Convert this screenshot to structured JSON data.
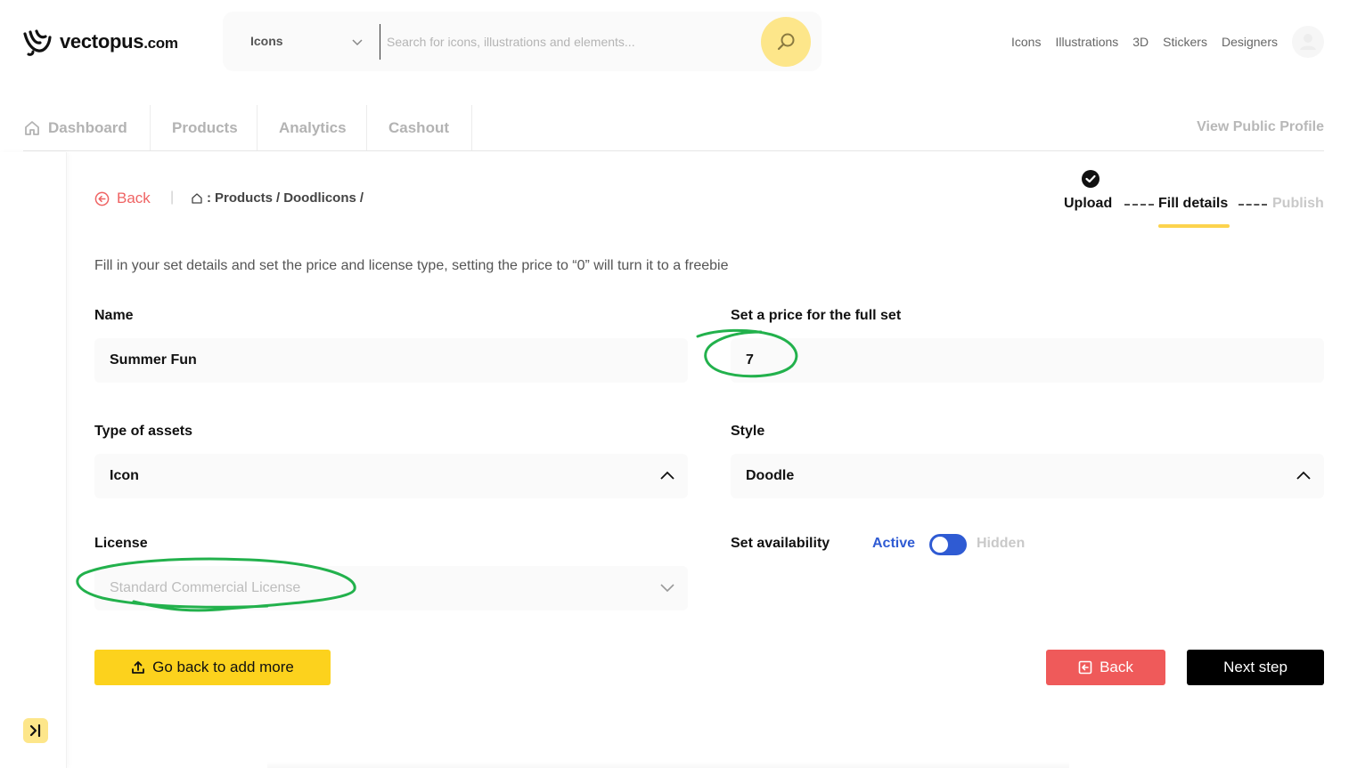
{
  "brand": {
    "name": "vectopus",
    "suffix": ".com"
  },
  "search": {
    "category": "Icons",
    "placeholder": "Search for icons, illustrations and elements..."
  },
  "topnav": [
    "Icons",
    "Illustrations",
    "3D",
    "Stickers",
    "Designers"
  ],
  "tabs": [
    {
      "label": "Dashboard",
      "icon": "home-icon"
    },
    {
      "label": "Products"
    },
    {
      "label": "Analytics"
    },
    {
      "label": "Cashout"
    }
  ],
  "view_profile": "View Public Profile",
  "back_label": "Back",
  "breadcrumb": {
    "root_sep": ":",
    "items": [
      "Products",
      "Doodlicons"
    ],
    "sep": "/"
  },
  "stepper": {
    "steps": [
      "Upload",
      "Fill details",
      "Publish"
    ],
    "completed": [
      "Upload"
    ],
    "current": "Fill details"
  },
  "intro": "Fill in your set details and set the price and license type, setting the price to “0” will turn it to a freebie",
  "form": {
    "name_label": "Name",
    "name_value": "Summer Fun",
    "price_label": "Set a price for the full set",
    "price_value": "7",
    "type_label": "Type of assets",
    "type_value": "Icon",
    "style_label": "Style",
    "style_value": "Doodle",
    "license_label": "License",
    "license_value": "Standard Commercial License",
    "availability_label": "Set availability",
    "availability_active": "Active",
    "availability_hidden": "Hidden",
    "availability_state": "Active"
  },
  "buttons": {
    "add_more": "Go back to add more",
    "back": "Back",
    "next": "Next step"
  },
  "colors": {
    "accent_yellow": "#fcd21d",
    "back_red": "#ef5a5a",
    "toggle_blue": "#2f5bd3",
    "annotation_green": "#22b14c"
  }
}
